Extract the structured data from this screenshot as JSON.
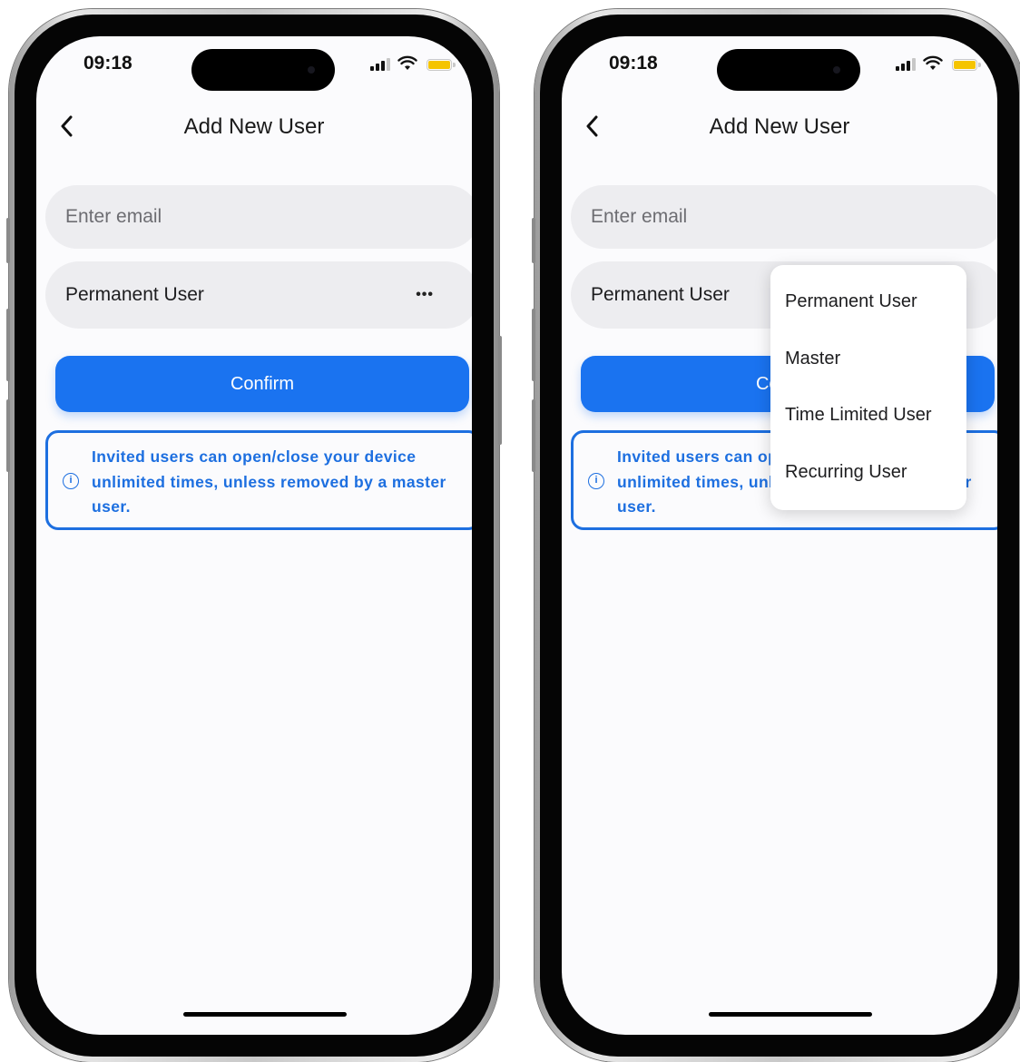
{
  "status_bar": {
    "time": "09:18"
  },
  "header": {
    "title": "Add New User"
  },
  "form": {
    "email_placeholder": "Enter email",
    "role_value": "Permanent User",
    "confirm_label": "Confirm"
  },
  "info": {
    "text": "Invited users can open/close your device unlimited times, unless removed by a master user."
  },
  "role_menu": {
    "options": [
      "Permanent User",
      "Master",
      "Time Limited User",
      "Recurring User"
    ]
  },
  "icons": {
    "back": "chevron-left-icon",
    "more": "ellipsis-icon",
    "info": "info-circle-icon",
    "signal": "cellular-signal-icon",
    "wifi": "wifi-icon",
    "battery": "battery-icon"
  },
  "colors": {
    "accent": "#1a73f0",
    "info_text": "#1d6fe0",
    "field_bg": "#ededf0",
    "screen_bg": "#fbfbfd",
    "battery": "#f5c400"
  }
}
